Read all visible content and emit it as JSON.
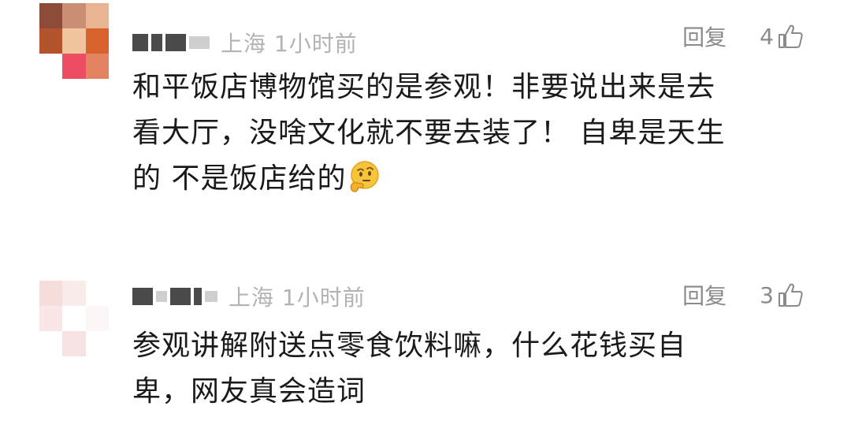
{
  "comments": [
    {
      "location_time": "上海 1小时前",
      "reply_label": "回复",
      "like_count": "4",
      "text_lines": [
        "和平饭店博物馆买的是参观！非要说出来是去",
        "看大厅，没啥文化就不要去装了！ 自卑是天生",
        "的 不是饭店给的"
      ],
      "emoji": "thinking-face",
      "avatar_colors": [
        "#8f4b3a",
        "#c98e74",
        "#e9b491",
        "#b4542c",
        "#f0c59e",
        "#d9632d",
        "#ffffff",
        "#ec4d63",
        "#e3835f"
      ]
    },
    {
      "location_time": "上海 1小时前",
      "reply_label": "回复",
      "like_count": "3",
      "text_lines": [
        "参观讲解附送点零食饮料嘛，什么花钱买自",
        "卑，网友真会造词"
      ],
      "avatar_colors": [
        "#f7dcdc",
        "#fbecec",
        "#ffffff",
        "#f9e6e6",
        "#ffffff",
        "#fdf6f6",
        "#ffffff",
        "#f6e2e2",
        "#ffffff"
      ]
    }
  ],
  "icons": {
    "like": "thumbs-up-icon",
    "emoji": "thinking-face-icon"
  }
}
